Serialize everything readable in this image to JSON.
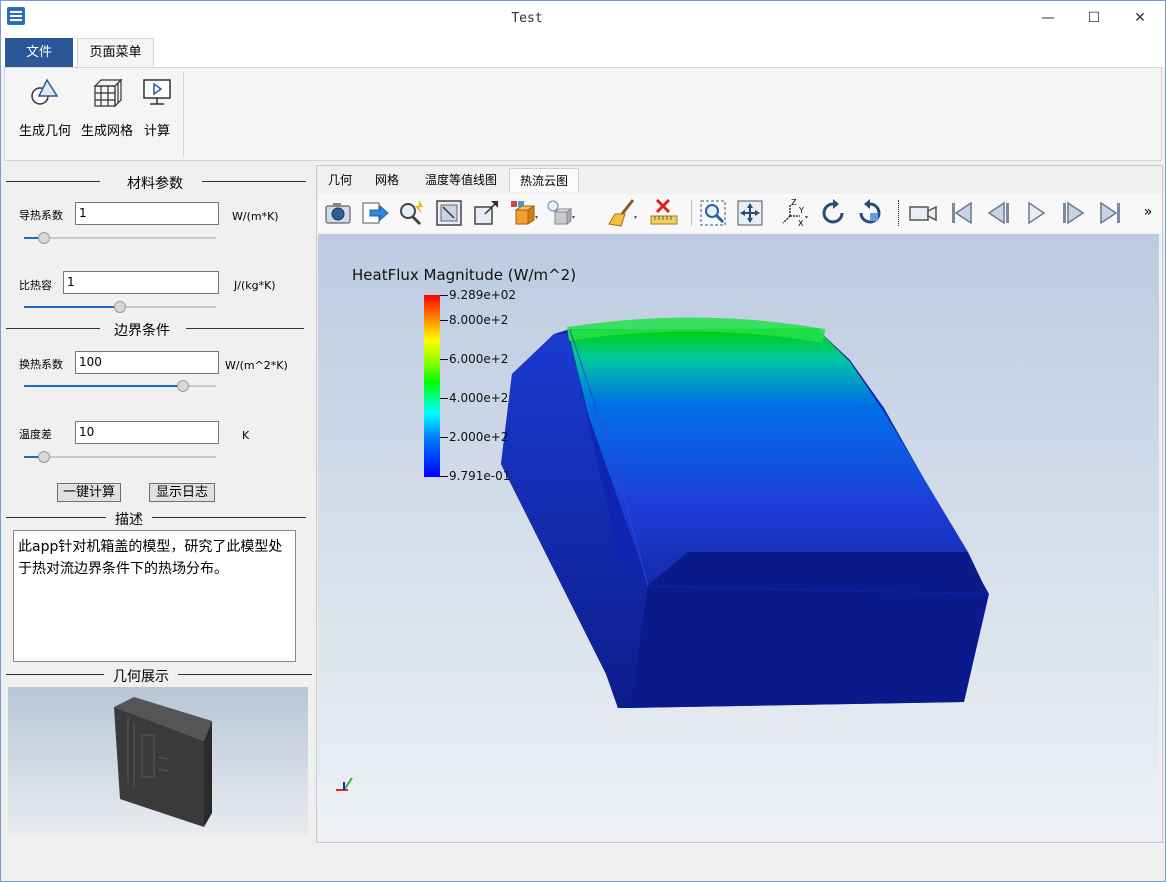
{
  "window": {
    "title": "Test",
    "minimize": "—",
    "maximize": "☐",
    "close": "✕"
  },
  "ribbon": {
    "tabs": [
      "文件",
      "页面菜单"
    ],
    "buttons": [
      {
        "label": "生成几何",
        "icon": "geometry-icon"
      },
      {
        "label": "生成网格",
        "icon": "mesh-icon"
      },
      {
        "label": "计算",
        "icon": "compute-icon"
      }
    ]
  },
  "left": {
    "material_group": "材料参数",
    "conductivity": {
      "label": "导热系数",
      "value": "1",
      "unit": "W/(m*K)",
      "slider": 0.08
    },
    "specific_heat": {
      "label": "比热容",
      "value": "1",
      "unit": "J/(kg*K)",
      "slider": 0.5
    },
    "boundary_group": "边界条件",
    "htc": {
      "label": "换热系数",
      "value": "100",
      "unit": "W/(m^2*K)",
      "slider": 0.85
    },
    "temp_diff": {
      "label": "温度差",
      "value": "10",
      "unit": "K",
      "slider": 0.08
    },
    "compute_button": "一键计算",
    "log_button": "显示日志",
    "desc_group": "描述",
    "description": "此app针对机箱盖的模型，研究了此模型处于热对流边界条件下的热场分布。",
    "geo_group": "几何展示"
  },
  "view": {
    "tabs": [
      "几何",
      "网格",
      "温度等值线图",
      "热流云图"
    ],
    "active_tab": 3,
    "toolbar_icons": [
      "camera-icon",
      "export-icon",
      "pick-icon",
      "fit-view-icon",
      "zoom-box-icon",
      "color-cube-icon",
      "light-icon",
      "clear-icon",
      "ruler-delete-icon",
      "zoom-window-icon",
      "pan-icon",
      "axes-icon",
      "rotate-cw-icon",
      "rotate-ccw-icon",
      "record-icon",
      "first-frame-icon",
      "prev-frame-icon",
      "play-icon",
      "next-frame-icon",
      "last-frame-icon"
    ],
    "more": "»",
    "legend": {
      "title": "HeatFlux Magnitude (W/m^2)",
      "labels": [
        "9.289e+02",
        "8.000e+2",
        "6.000e+2",
        "4.000e+2",
        "2.000e+2",
        "9.791e-01"
      ]
    }
  }
}
